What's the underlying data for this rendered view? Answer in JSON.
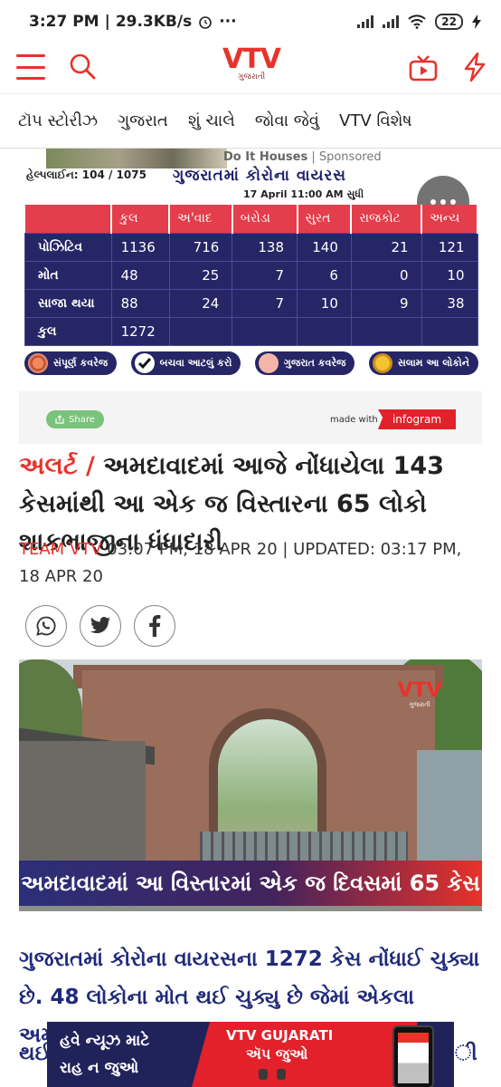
{
  "status_bar": {
    "time": "3:27 PM",
    "net_speed": "29.3KB/s",
    "battery": "22"
  },
  "header": {
    "logo_text": "VTV",
    "logo_sub": "ગુજરાતી"
  },
  "tabs": [
    "ટૉપ સ્ટોરીઝ",
    "ગુજરાત",
    "શું ચાલે",
    "જોવા જેવું",
    "VTV વિશેષ"
  ],
  "ad": {
    "source": "Do It Houses",
    "label": "Sponsored"
  },
  "infographic": {
    "helpline": "હેલ્પલાઈન: 104 / 1075",
    "title": "ગુજરાતમાં કોરોના વાયરસ",
    "date": "17 April 11:00 AM સુધી",
    "columns": [
      "",
      "કુલ",
      "અ'વાદ",
      "બરોડા",
      "સુરત",
      "રાજકોટ",
      "અન્ય"
    ],
    "rows": [
      {
        "label": "પોઝિટિવ",
        "values": [
          "1136",
          "716",
          "138",
          "140",
          "21",
          "121"
        ]
      },
      {
        "label": "મોત",
        "values": [
          "48",
          "25",
          "7",
          "6",
          "0",
          "10"
        ]
      },
      {
        "label": "સાજા થયા",
        "values": [
          "88",
          "24",
          "7",
          "10",
          "9",
          "38"
        ]
      },
      {
        "label": "કુલ",
        "values": [
          "1272",
          "",
          "",
          "",
          "",
          ""
        ]
      }
    ],
    "pills": [
      "સંપૂર્ણ કવરેજ",
      "બચવા આટલું કરો",
      "ગુજરાત કવરેજ",
      "સલામ આ લોકોને"
    ],
    "share_label": "Share",
    "made_with": "made with",
    "brand": "infogram"
  },
  "article": {
    "tag": "અલર્ટ /",
    "headline": "અમદાવાદમાં આજે નોંધાયેલા 143 કેસમાંથી આ એક જ વિસ્તારના 65 લોકો શાકભાજીના ધંધાદારી",
    "author": "TEAM VTV",
    "meta": "03:07 PM, 18 APR 20 | UPDATED: 03:17 PM, 18 APR 20",
    "image_logo": "VTV",
    "image_logo_sub": "ગુજરાતી",
    "image_caption": "અમદાવાદમાં આ વિસ્તારમાં એક જ દિવસમાં 65 કેસ",
    "body": "ગુજરાતમાં કોરોના વાયરસના 1272 કેસ નોંધાઈ ચુક્યા છે. 48 લોકોના મોત થઈ ચુક્યુ છે જેમાં એકલા અમદાવાદમાં જ",
    "body_tail_left": "થઈ",
    "body_tail_right": "ી"
  },
  "banner": {
    "line1": "હવે ન્યૂઝ માટે",
    "line2": "રાહ ન જુઓ",
    "brand": "VTV GUJARATI",
    "cta": "ઍપ જુઓ"
  },
  "colors": {
    "accent": "#e8322a",
    "navy": "#262566",
    "table_header": "#e43d4b"
  }
}
